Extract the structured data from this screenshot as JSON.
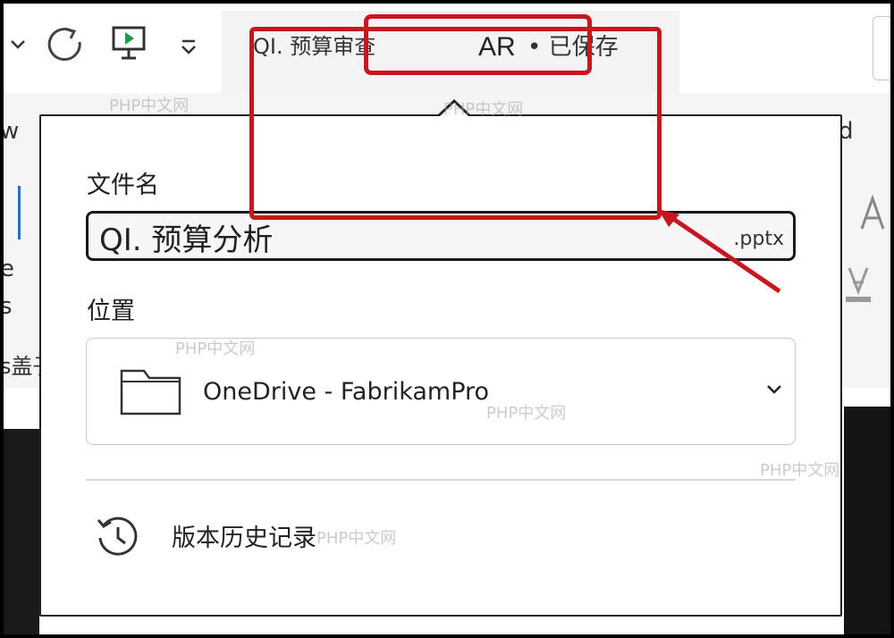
{
  "title_bar": {
    "doc_title": "QI. 预算审查",
    "author_initials": "AR",
    "separator": "•",
    "save_status": "已保存"
  },
  "ribbon_fragments": {
    "left_tab": "w",
    "right_tab": "d",
    "left_e": "e",
    "left_s": "s",
    "left_text": "s盖子"
  },
  "popup": {
    "filename_label": "文件名",
    "filename_value": "QI. 预算分析",
    "filename_ext": ".pptx",
    "location_label": "位置",
    "location_value": "OneDrive - FabrikamPro",
    "history_label": "版本历史记录"
  },
  "watermarks": [
    "PHP中文网",
    "PHP中文网",
    "PHP中文网",
    "PHP中文网",
    "PHP中文网",
    "PHP中文网"
  ],
  "colors": {
    "annotation_red": "#c8161e",
    "popup_border": "#222222",
    "title_area_bg": "#f3f3f3"
  },
  "icons": [
    "chevron-down-icon",
    "redo-icon",
    "present-icon",
    "customize-qat-icon",
    "folder-icon",
    "history-icon",
    "chevron-down-icon"
  ]
}
